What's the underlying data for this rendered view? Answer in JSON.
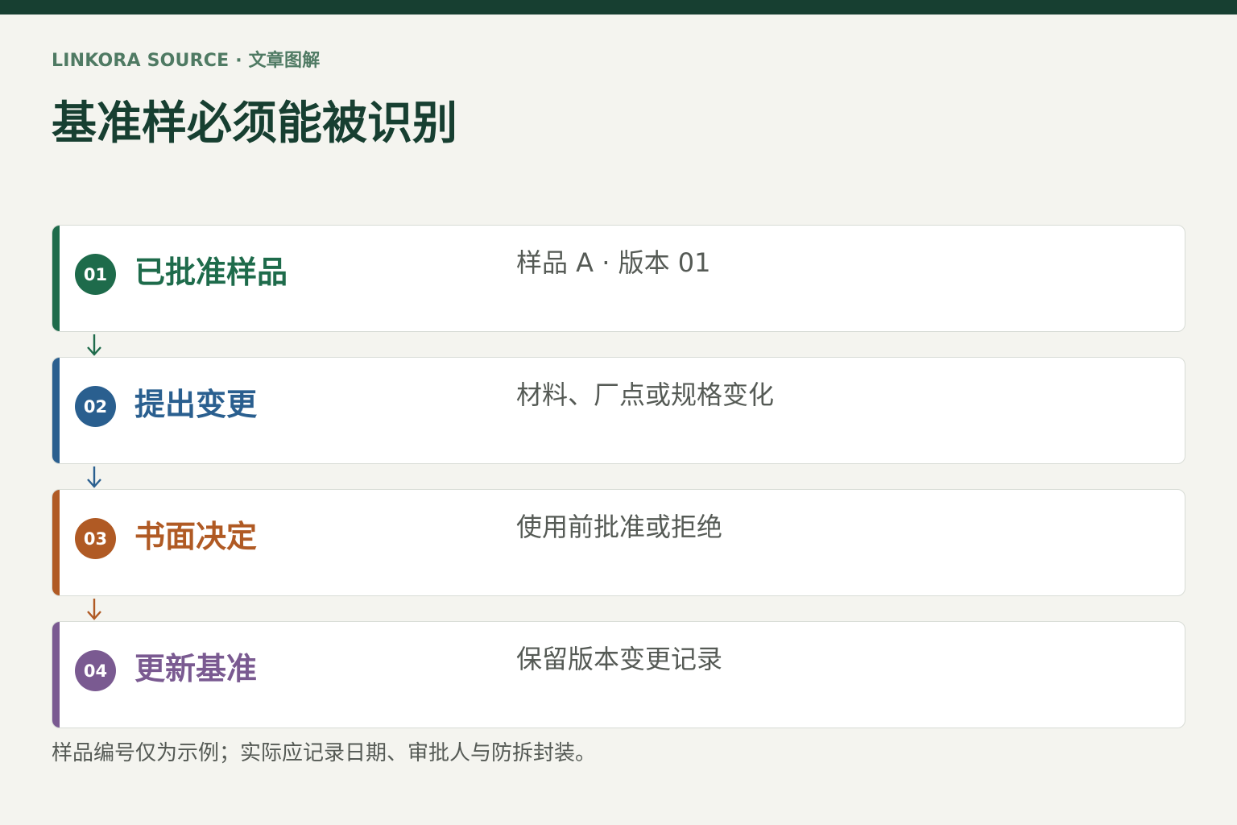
{
  "kicker": "LINKORA SOURCE · 文章图解",
  "title": "基准样必须能被识别",
  "steps": [
    {
      "number": "01",
      "title": "已批准样品",
      "description": "样品 A · 版本 01",
      "color": "#1e6b4b"
    },
    {
      "number": "02",
      "title": "提出变更",
      "description": "材料、厂点或规格变化",
      "color": "#2a5f8f"
    },
    {
      "number": "03",
      "title": "书面决定",
      "description": "使用前批准或拒绝",
      "color": "#b05a24"
    },
    {
      "number": "04",
      "title": "更新基准",
      "description": "保留版本变更记录",
      "color": "#7a5a91"
    }
  ],
  "arrow_icon": "arrow-down-icon",
  "footnote": "样品编号仅为示例；实际应记录日期、审批人与防拆封装。",
  "colors": {
    "top_bar": "#173f31",
    "background": "#f4f4ef",
    "title": "#173f31",
    "kicker": "#4f7a63"
  }
}
